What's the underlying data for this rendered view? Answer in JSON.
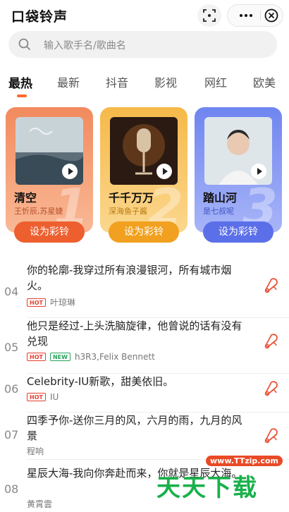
{
  "header": {
    "title": "口袋铃声"
  },
  "search": {
    "placeholder": "输入歌手名/歌曲名"
  },
  "tabs": [
    {
      "label": "最热",
      "active": true
    },
    {
      "label": "最新"
    },
    {
      "label": "抖音"
    },
    {
      "label": "影视"
    },
    {
      "label": "网红"
    },
    {
      "label": "欧美"
    }
  ],
  "top_cards": [
    {
      "rank": "1",
      "song": "清空",
      "artist": "王忻辰,苏星婕",
      "button": "设为彩铃",
      "color": "#f28a5e"
    },
    {
      "rank": "2",
      "song": "千千万万",
      "artist": "深海鱼子酱",
      "button": "设为彩铃",
      "color": "#f6b94a"
    },
    {
      "rank": "3",
      "song": "踏山河",
      "artist": "是七叔呢",
      "button": "设为彩铃",
      "color": "#6f85f0"
    }
  ],
  "list": [
    {
      "rank": "04",
      "title": "你的轮廓-我穿过所有浪漫银河，所有城市烟火。",
      "badges": [
        "HOT"
      ],
      "artist": "叶琼琳"
    },
    {
      "rank": "05",
      "title": "他只是经过-上头洗脑旋律，他曾说的话有没有兑现",
      "badges": [
        "HOT",
        "NEW"
      ],
      "artist": "h3R3,Felix Bennett"
    },
    {
      "rank": "06",
      "title": "Celebrity-IU新歌，甜美依旧。",
      "badges": [
        "HOT"
      ],
      "artist": "IU"
    },
    {
      "rank": "07",
      "title": "四季予你-送你三月的风，六月的雨，九月的风景",
      "badges": [],
      "artist": "程响"
    },
    {
      "rank": "08",
      "title": "星辰大海-我向你奔赴而来，你就是星辰大海。",
      "badges": [],
      "artist": "黄霄雲"
    }
  ],
  "watermark": {
    "url": "www.TTzip.com",
    "text": "天天下载"
  },
  "colors": {
    "accent": "#ff6a2b",
    "hot": "#e43f2e",
    "new": "#25a35a",
    "bell": "#e8533a"
  }
}
